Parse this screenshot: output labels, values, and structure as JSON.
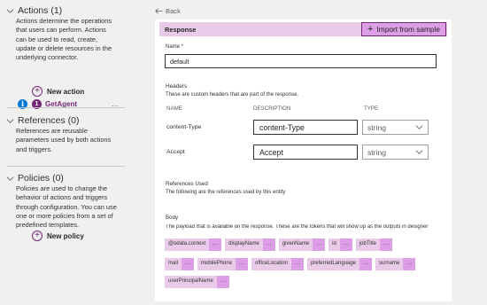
{
  "sidebar": {
    "actions": {
      "title": "Actions (1)",
      "description": "Actions determine the operations that users can perform. Actions can be used to read, create, update or delete resources in the underlying connector.",
      "item": {
        "count": "1",
        "name": "GetAgent",
        "more": "…"
      },
      "add_label": "New action"
    },
    "references": {
      "title": "References (0)",
      "description": "References are reusable parameters used by both actions and triggers."
    },
    "policies": {
      "title": "Policies (0)",
      "description": "Policies are used to change the behavior of actions and triggers through configuration. You can use one or more policies from a set of predefined templates.",
      "add_label": "New policy"
    }
  },
  "main": {
    "back_label": "Back",
    "response": {
      "title": "Response",
      "import_label": "Import from sample"
    },
    "name": {
      "label": "Name *",
      "value": "default"
    },
    "headers": {
      "title": "Headers",
      "description": "These are custom headers that are part of the response.",
      "columns": [
        "NAME",
        "DESCRIPTION",
        "TYPE"
      ],
      "rows": [
        {
          "name": "content-Type",
          "description": "content-Type",
          "type": "string"
        },
        {
          "name": "Accept",
          "description": "Accept",
          "type": "string"
        }
      ]
    },
    "references_used": {
      "title": "References Used",
      "description": "The following are the references used by this entity"
    },
    "body": {
      "title": "Body",
      "description": "The payload that is available on the response. These are the tokens that will show up as the outputs in designer",
      "token_more": "…",
      "tokens": [
        [
          "@odata.context",
          "displayName",
          "givenName",
          "id",
          "jobTitle"
        ],
        [
          "mail",
          "mobilePhone",
          "officeLocation",
          "preferredLanguage",
          "surname"
        ],
        [
          "userPrincipalName"
        ]
      ]
    }
  },
  "colors": {
    "accent": "#742774",
    "header_bg": "#e9cbe9",
    "button_bg": "#dc9ee4",
    "info": "#0078d4",
    "panel_bg": "#f0f0f0"
  }
}
